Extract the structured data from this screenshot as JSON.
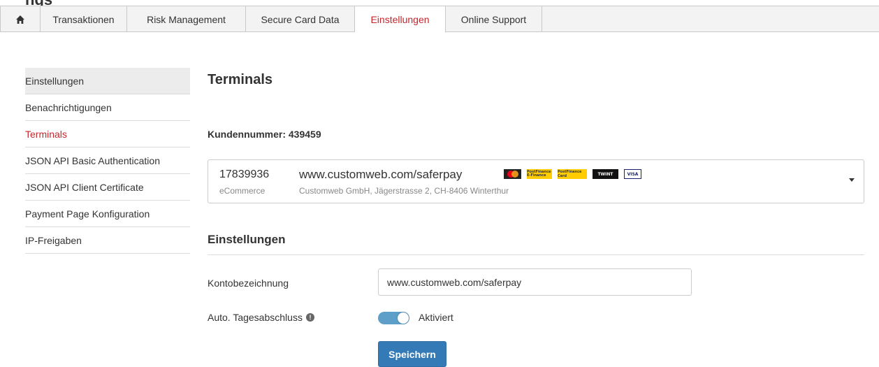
{
  "page": {
    "clipped_heading": "ngs"
  },
  "nav": {
    "home_icon": "home-icon",
    "tabs": [
      {
        "label": "Transaktionen"
      },
      {
        "label": "Risk Management"
      },
      {
        "label": "Secure Card Data"
      },
      {
        "label": "Einstellungen",
        "active": true
      },
      {
        "label": "Online Support"
      }
    ]
  },
  "sidebar": {
    "header": "Einstellungen",
    "items": [
      {
        "label": "Benachrichtigungen"
      },
      {
        "label": "Terminals",
        "active": true
      },
      {
        "label": "JSON API Basic Authentication"
      },
      {
        "label": "JSON API Client Certificate"
      },
      {
        "label": "Payment Page Konfiguration"
      },
      {
        "label": "IP-Freigaben"
      }
    ]
  },
  "main": {
    "title": "Terminals",
    "customer_number": "Kundennummer: 439459",
    "terminal": {
      "id": "17839936",
      "type": "eCommerce",
      "url": "www.customweb.com/saferpay",
      "address": "Customweb GmbH, Jägerstrasse 2, CH-8406 Winterthur",
      "payment_methods": {
        "postfinance_efinance": "PostFinance E-Finance",
        "postfinance_card": "PostFinance Card",
        "twint": "TWINT",
        "visa": "VISA"
      }
    },
    "settings_title": "Einstellungen",
    "account_label": "Kontobezeichnung",
    "account_value": "www.customweb.com/saferpay",
    "auto_close_label": "Auto. Tagesabschluss",
    "toggle_state_label": "Aktiviert",
    "save_label": "Speichern"
  },
  "colors": {
    "accent_red": "#c3272d",
    "primary_button": "#337ab7",
    "toggle_on": "#5d9fc9"
  }
}
